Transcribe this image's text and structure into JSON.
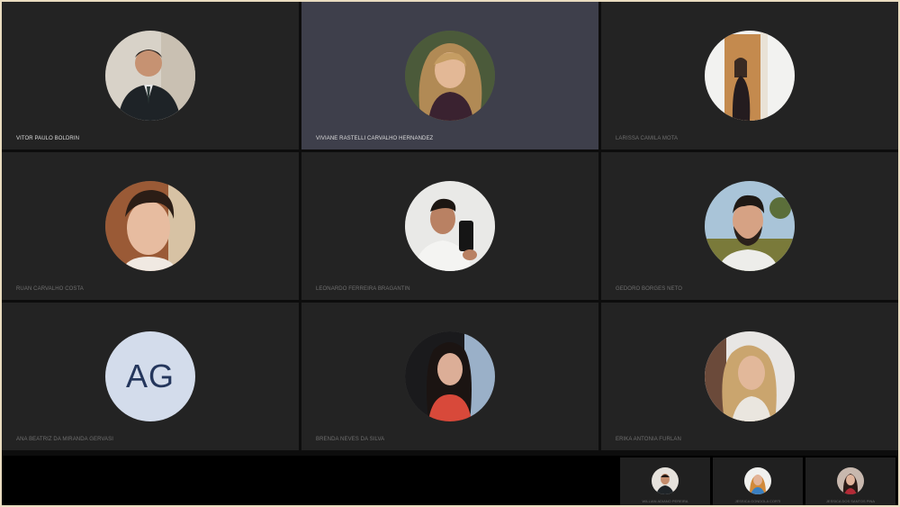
{
  "participants": [
    {
      "name": "VITOR PAULO BOLDRIN",
      "active": false
    },
    {
      "name": "VIVIANE RASTELLI CARVALHO HERNANDEZ",
      "active": true
    },
    {
      "name": "LARISSA CAMILA MOTA",
      "active": false
    },
    {
      "name": "RUAN CARVALHO COSTA",
      "active": false
    },
    {
      "name": "LEONARDO FERREIRA BRAGANTIN",
      "active": false
    },
    {
      "name": "GEDORO BORGES NETO",
      "active": false
    },
    {
      "name": "ANA BEATRIZ DA MIRANDA GERVASI",
      "initials": "AG",
      "active": false
    },
    {
      "name": "BRENDA NEVES DA SILVA",
      "active": false
    },
    {
      "name": "ERIKA ANTONIA FURLAN",
      "active": false
    }
  ],
  "overflow": [
    {
      "name": "WILLIAN ADIANO PEREIRA"
    },
    {
      "name": "JESSICA GONDOLA CORTI"
    },
    {
      "name": "JESSICA DOS SANTOS PINA"
    }
  ],
  "colors": {
    "tile": "#232323",
    "active_tile": "#3e3f4b",
    "initials_bg": "#d3dceb",
    "initials_fg": "#24365c",
    "border": "#e9dcc0"
  }
}
